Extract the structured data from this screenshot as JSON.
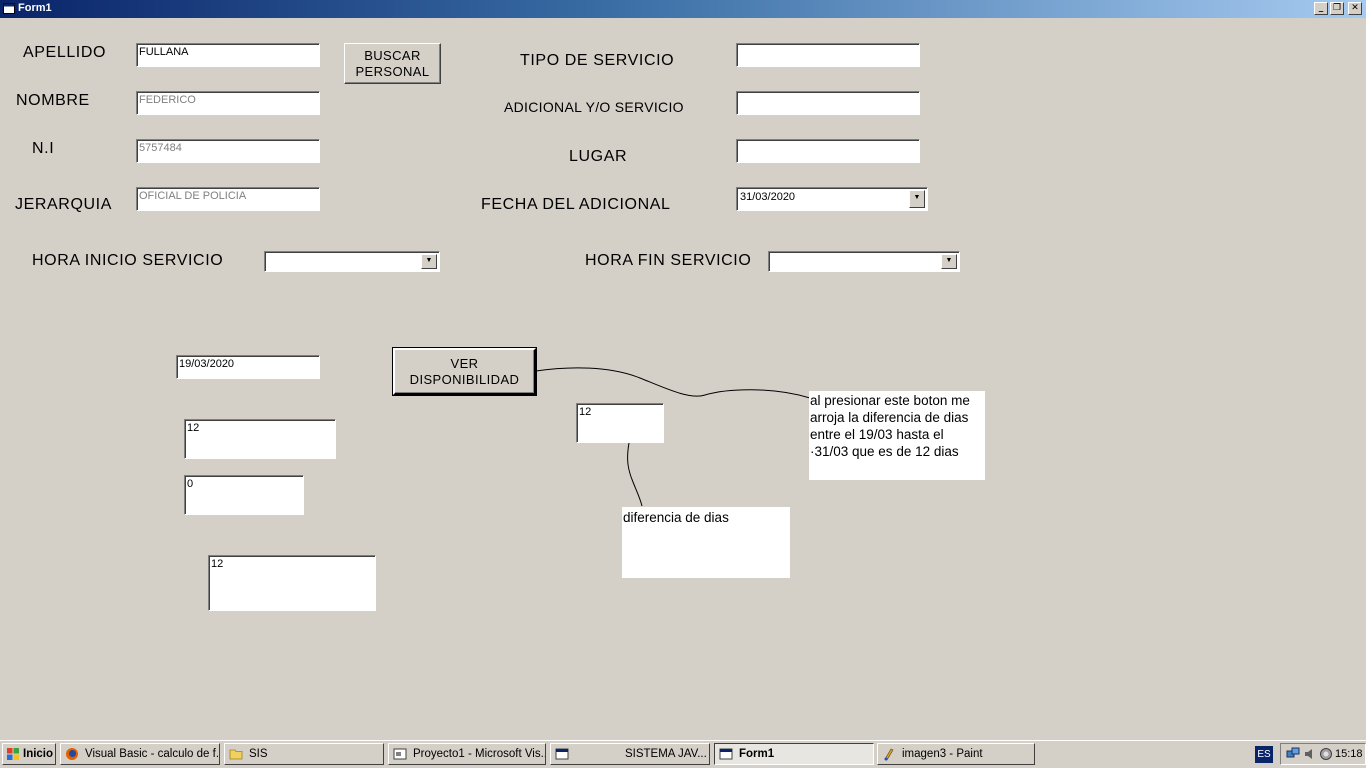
{
  "window": {
    "title": "Form1",
    "controls": {
      "minimize": "_",
      "restore": "❐",
      "close": "✕"
    }
  },
  "form": {
    "labels": {
      "apellido": "APELLIDO",
      "nombre": "NOMBRE",
      "ni": "N.I",
      "jerarquia": "JERARQUIA",
      "tipo_servicio": "TIPO DE SERVICIO",
      "adicional_servicio": "ADICIONAL Y/O SERVICIO",
      "lugar": "LUGAR",
      "fecha_adicional": "FECHA DEL ADICIONAL",
      "hora_inicio": "HORA INICIO SERVICIO",
      "hora_fin": "HORA FIN SERVICIO"
    },
    "fields": {
      "apellido": "FULLANA",
      "nombre": "FEDERICO",
      "ni": "5757484",
      "jerarquia": "OFICIAL DE POLICIA",
      "tipo_servicio": "",
      "adicional_servicio": "",
      "lugar": "",
      "fecha_adicional": "31/03/2020",
      "hora_inicio": "",
      "hora_fin": "",
      "fecha_inicio": "19/03/2020",
      "box_a": "12",
      "box_b": "0",
      "box_c": "12",
      "diferencia": "12"
    },
    "buttons": {
      "buscar_personal_line1": "BUSCAR",
      "buscar_personal_line2": "PERSONAL",
      "ver_disponibilidad_line1": "VER",
      "ver_disponibilidad_line2": "DISPONIBILIDAD"
    },
    "annotations": {
      "note_button": [
        "al presionar este boton me",
        "arroja la diferencia de dias",
        "entre el 19/03 hasta el",
        "·31/03 que es de 12 dias"
      ],
      "note_field": "diferencia de dias"
    }
  },
  "taskbar": {
    "start_label": "Inicio",
    "tasks": [
      {
        "label": "Visual Basic - calculo de f...",
        "icon": "firefox-icon"
      },
      {
        "label": "SIS",
        "icon": "folder-icon"
      },
      {
        "label": "Proyecto1 - Microsoft Vis...",
        "icon": "vb-icon"
      },
      {
        "label": "SISTEMA JAV...",
        "icon": "window-icon"
      },
      {
        "label": "Form1",
        "icon": "form-icon",
        "active": true
      },
      {
        "label": "imagen3 - Paint",
        "icon": "paint-icon"
      }
    ],
    "language": "ES",
    "clock": "15:18"
  }
}
